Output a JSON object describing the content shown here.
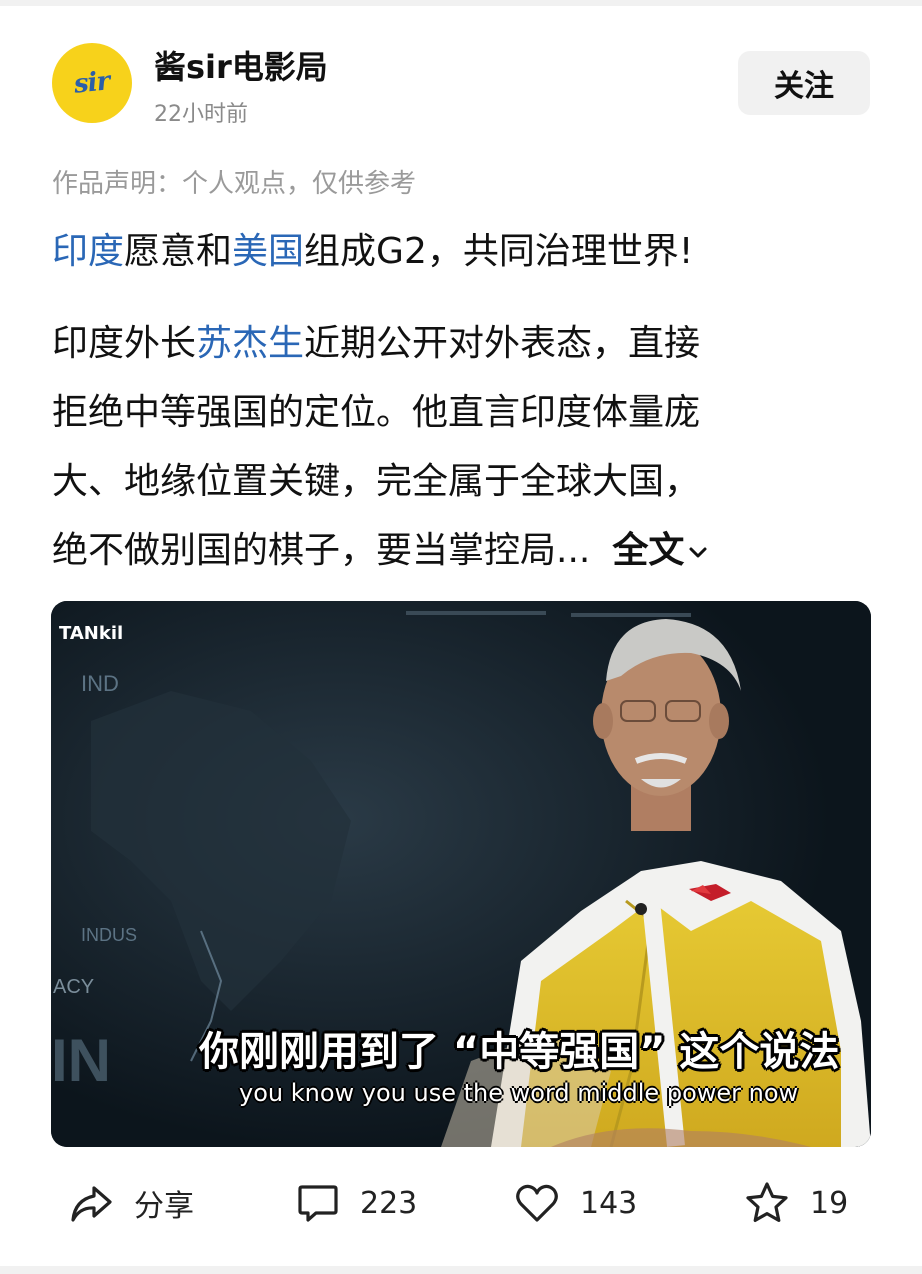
{
  "author": {
    "avatar_text": "sir",
    "name": "酱sir电影局",
    "time": "22小时前",
    "follow_label": "关注"
  },
  "post": {
    "disclaimer": "作品声明：个人观点，仅供参考",
    "headline": {
      "p1": "印度",
      "p2": "愿意和",
      "p3": "美国",
      "p4": "组成G2，共同治理世界!"
    },
    "body": {
      "l1a": "印度外长",
      "l1b": "苏杰生",
      "l1c": "近期公开对外表态，直接",
      "l2": "拒绝中等强国的定位。他直言印度体量庞",
      "l3": "大、地缘位置关键，完全属于全球大国，",
      "l4": "绝不做别国的棋子，要当掌控局...",
      "more_label": "全文"
    },
    "video": {
      "channel_logo": "TANkil",
      "subtitle_zh": "你刚刚用到了 “中等强国” 这个说法",
      "subtitle_en": "you know you use the word middle power now"
    }
  },
  "actions": {
    "share_label": "分享",
    "comments": "223",
    "likes": "143",
    "favorites": "19"
  },
  "colors": {
    "link_blue": "#2a67b6",
    "avatar_yellow": "#f7d21b",
    "vest_yellow": "#e0c12a"
  }
}
